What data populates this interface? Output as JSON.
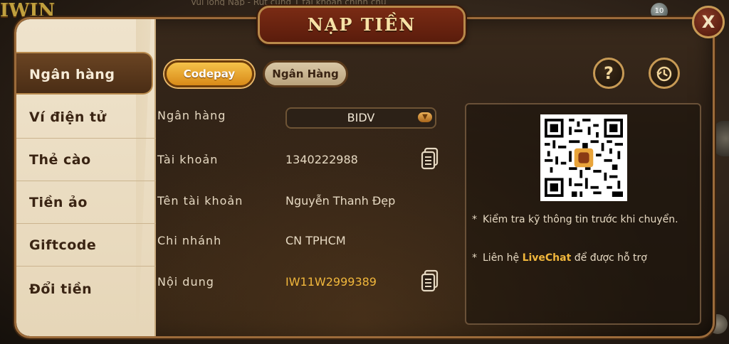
{
  "backdrop": {
    "marquee": "Vui lòng Nạp - Rút cùng 1 tài khoản chính chủ",
    "logo_text": "IWIN",
    "coin_badge": "10"
  },
  "dialog": {
    "title": "NẠP TIỀN",
    "close_label": "X"
  },
  "sidebar": {
    "items": [
      {
        "label": "Ngân hàng",
        "active": true
      },
      {
        "label": "Ví điện tử",
        "active": false
      },
      {
        "label": "Thẻ cào",
        "active": false
      },
      {
        "label": "Tiền ảo",
        "active": false
      },
      {
        "label": "Giftcode",
        "active": false
      },
      {
        "label": "Đổi tiền",
        "active": false
      }
    ]
  },
  "tabs": {
    "codepay": "Codepay",
    "nganhang": "Ngân Hàng"
  },
  "buttons": {
    "help": "?",
    "history_icon": "history-icon"
  },
  "form": {
    "bank_label": "Ngân hàng",
    "bank_value": "BIDV",
    "account_label": "Tài khoản",
    "account_value": "1340222988",
    "account_name_label": "Tên tài khoản",
    "account_name_value": "Nguyễn Thanh Đẹp",
    "branch_label": "Chi nhánh",
    "branch_value": "CN TPHCM",
    "content_label": "Nội dung",
    "content_value": "IW11W2999389"
  },
  "info": {
    "note1": "Kiểm tra kỹ thông tin trước khi chuyển.",
    "note2_prefix": "Liên hệ ",
    "note2_link": "LiveChat",
    "note2_suffix": " để được hỗ trợ"
  },
  "colors": {
    "accent_gold": "#f1b73c",
    "panel_border": "#9c6b3a",
    "sidebar_bg": "#efe3cc"
  }
}
